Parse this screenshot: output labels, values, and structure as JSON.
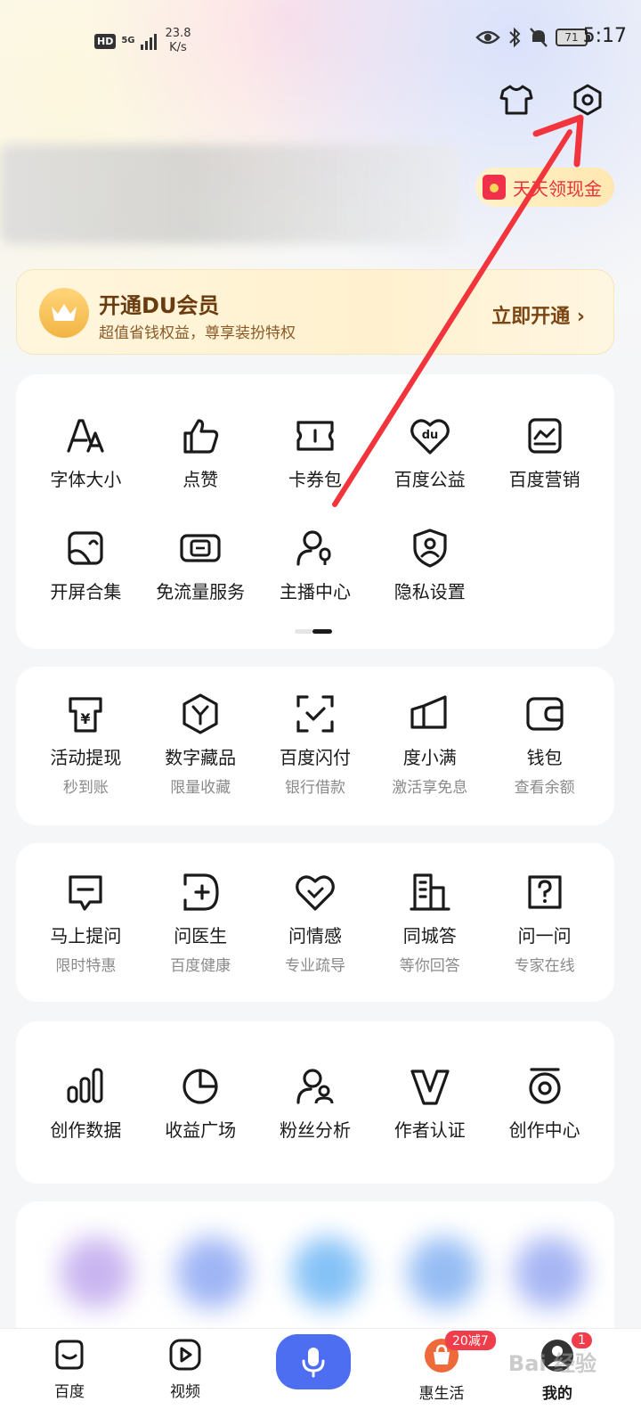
{
  "status_bar": {
    "hd": "HD",
    "network": "5G",
    "speed_value": "23.8",
    "speed_unit": "K/s",
    "battery": "71",
    "time": "5:17"
  },
  "header": {
    "redpacket_label": "天天领现金"
  },
  "member": {
    "title": "开通DU会员",
    "subtitle": "超值省钱权益，尊享装扮特权",
    "cta": "立即开通 ›"
  },
  "tools": {
    "row1": [
      {
        "label": "字体大小"
      },
      {
        "label": "点赞"
      },
      {
        "label": "卡券包"
      },
      {
        "label": "百度公益"
      },
      {
        "label": "百度营销"
      }
    ],
    "row2": [
      {
        "label": "开屏合集"
      },
      {
        "label": "免流量服务"
      },
      {
        "label": "主播中心"
      },
      {
        "label": "隐私设置"
      }
    ]
  },
  "finance": [
    {
      "label": "活动提现",
      "sub": "秒到账"
    },
    {
      "label": "数字藏品",
      "sub": "限量收藏"
    },
    {
      "label": "百度闪付",
      "sub": "银行借款"
    },
    {
      "label": "度小满",
      "sub": "激活享免息"
    },
    {
      "label": "钱包",
      "sub": "查看余额"
    }
  ],
  "ask": [
    {
      "label": "马上提问",
      "sub": "限时特惠"
    },
    {
      "label": "问医生",
      "sub": "百度健康"
    },
    {
      "label": "问情感",
      "sub": "专业疏导"
    },
    {
      "label": "同城答",
      "sub": "等你回答"
    },
    {
      "label": "问一问",
      "sub": "专家在线"
    }
  ],
  "creator": [
    {
      "label": "创作数据"
    },
    {
      "label": "收益广场"
    },
    {
      "label": "粉丝分析"
    },
    {
      "label": "作者认证"
    },
    {
      "label": "创作中心"
    }
  ],
  "bottom_nav": {
    "home": "百度",
    "video": "视频",
    "life": "惠生活",
    "mine": "我的",
    "life_badge": "20减7",
    "mine_badge": "1"
  },
  "watermark": "Bai 经验",
  "colors": {
    "accent": "#4e6ef2",
    "annotation_arrow": "#f2353c",
    "badge": "#f03d4b"
  }
}
